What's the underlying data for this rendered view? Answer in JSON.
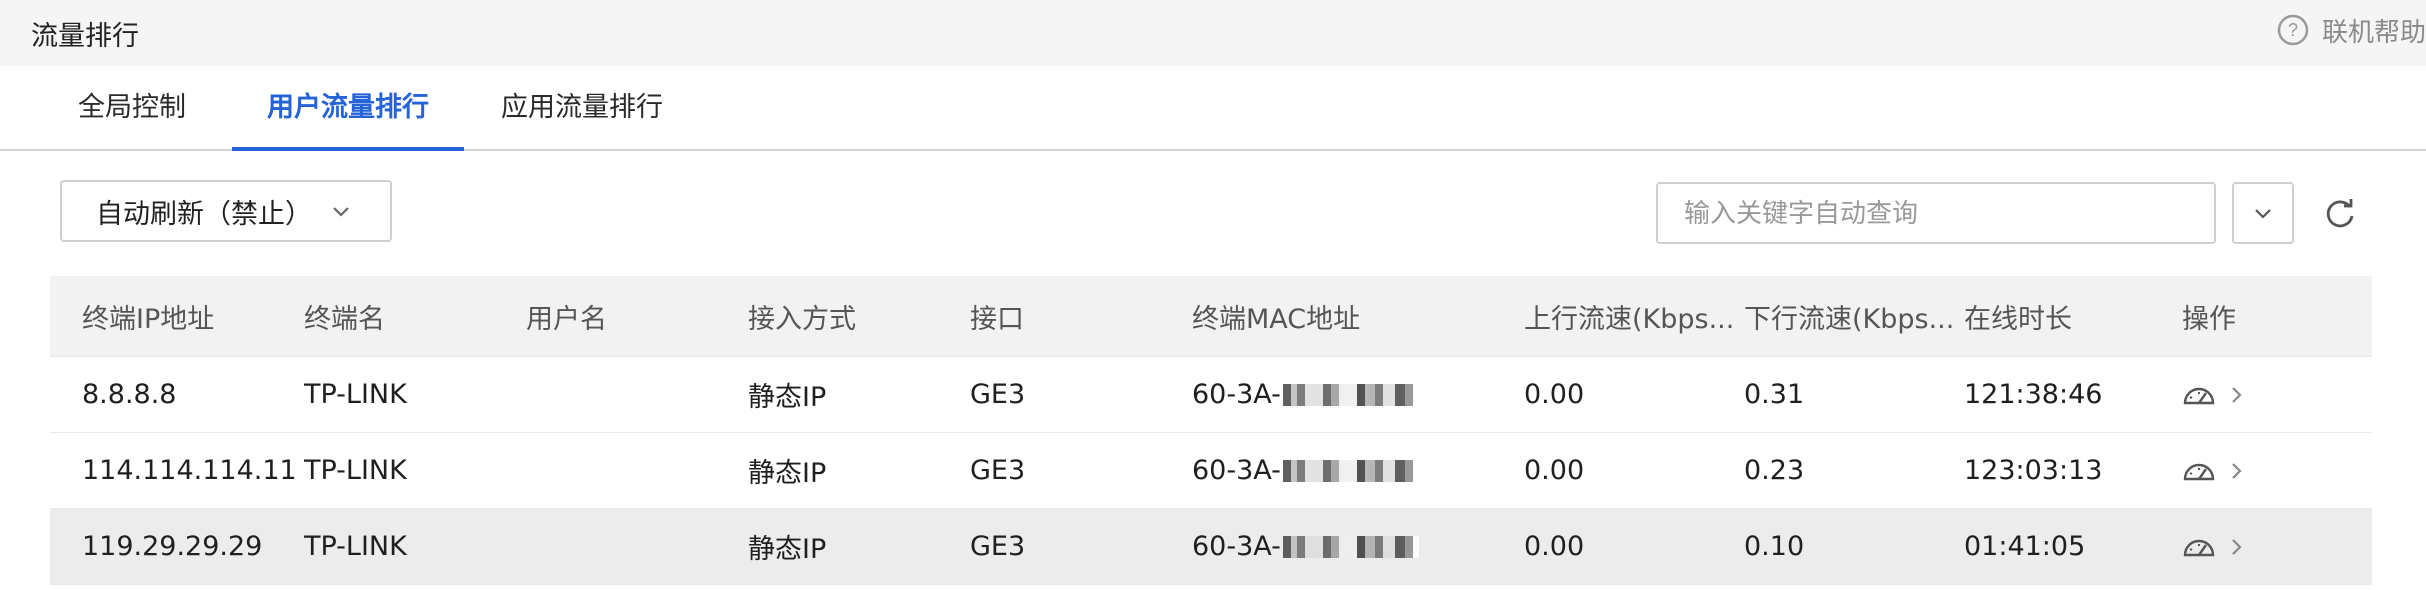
{
  "header": {
    "title": "流量排行",
    "help_label": "联机帮助"
  },
  "tabs": [
    {
      "label": "全局控制",
      "active": false
    },
    {
      "label": "用户流量排行",
      "active": true
    },
    {
      "label": "应用流量排行",
      "active": false
    }
  ],
  "toolbar": {
    "refresh_select": "自动刷新（禁止）",
    "search_placeholder": "输入关键字自动查询"
  },
  "table": {
    "columns": [
      "终端IP地址",
      "终端名",
      "用户名",
      "接入方式",
      "接口",
      "终端MAC地址",
      "上行流速(Kbps...",
      "下行流速(Kbps...",
      "在线时长",
      "操作"
    ],
    "rows": [
      {
        "ip": "8.8.8.8",
        "name": "TP-LINK",
        "user": "",
        "access": "静态IP",
        "iface": "GE3",
        "mac_prefix": "60-3A-",
        "up": "0.00",
        "down": "0.31",
        "online": "121:38:46"
      },
      {
        "ip": "114.114.114.11",
        "name": "TP-LINK",
        "user": "",
        "access": "静态IP",
        "iface": "GE3",
        "mac_prefix": "60-3A-",
        "up": "0.00",
        "down": "0.23",
        "online": "123:03:13"
      },
      {
        "ip": "119.29.29.29",
        "name": "TP-LINK",
        "user": "",
        "access": "静态IP",
        "iface": "GE3",
        "mac_prefix": "60-3A-",
        "up": "0.00",
        "down": "0.10",
        "online": "01:41:05"
      }
    ]
  },
  "colors": {
    "accent": "#2563d6",
    "header_bg": "#f5f5f5",
    "table_header_bg": "#f2f2f2",
    "hover_row_bg": "#ececec"
  },
  "icons": {
    "help": "help-circle-icon",
    "dropdown": "chevron-down-icon",
    "refresh": "refresh-icon",
    "op_monitor": "speedometer-icon",
    "op_more": "chevron-right-icon"
  }
}
